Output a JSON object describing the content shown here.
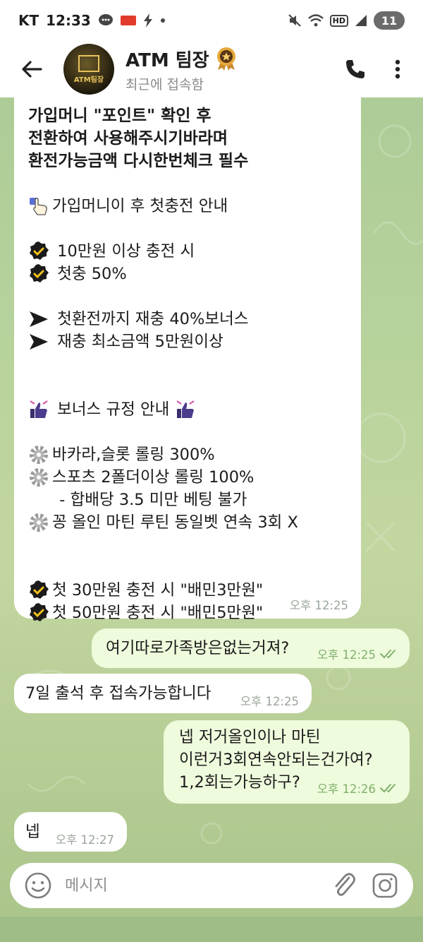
{
  "status_bar": {
    "carrier": "KT",
    "time": "12:33",
    "battery_level": "11",
    "network_badge": "HD"
  },
  "header": {
    "title": "ATM 팀장",
    "subtitle": "최근에 접속함",
    "avatar_text": "ATM팀장"
  },
  "messages": {
    "m1": {
      "lines": [
        "가입머니 \"포인트\" 확인 후",
        "전환하여 사용해주시기바라며",
        "환전가능금액 다시한번체크 필수",
        "가입머니이 후 첫충전 안내",
        " 10만원 이상 충전 시",
        " 첫충 50%",
        " 첫환전까지 재충 40%보너스",
        " 재충 최소금액 5만원이상",
        " 보너스 규정 안내 ",
        "바카라,슬롯 롤링 300%",
        "스포츠 2폴더이상 롤링 100%",
        "  - 합배당 3.5 미만 베팅 불가",
        "꽁 올인 마틴 루틴 동일벳 연속 3회 X",
        "첫 30만원 충전 시 \"배민3만원\"",
        "첫 50만원 충전 시 \"배민5만원\""
      ],
      "time": "오후 12:25"
    },
    "m2": {
      "text": "여기따로가족방은없는거져?",
      "time": "오후 12:25"
    },
    "m3": {
      "text": "7일 출석 후 접속가능합니다",
      "time": "오후 12:25"
    },
    "m4": {
      "lines": [
        "넵 저거올인이나 마틴",
        "이런거3회연속안되는건가여?",
        "1,2회는가능하구?"
      ],
      "time": "오후 12:26"
    },
    "m5": {
      "text": "넵",
      "time": "오후 12:27"
    }
  },
  "input": {
    "placeholder": "메시지"
  },
  "colors": {
    "incoming_bubble": "#ffffff",
    "outgoing_bubble": "#effbdd",
    "read_check": "#7fb06b",
    "chat_background": "#b7d29c"
  },
  "icons": {
    "back": "arrow-left-icon",
    "call": "phone-icon",
    "more": "kebab-menu-icon",
    "emoji": "smiley-icon",
    "attach": "paperclip-icon",
    "camera": "camera-icon",
    "check": "check-badge-icon",
    "arrow": "arrow-pointer-icon",
    "gear": "gear-icon",
    "thumbs": "thumbs-up-icon",
    "hand": "pointing-hand-icon",
    "read": "double-check-icon",
    "verified": "medal-badge-icon"
  }
}
